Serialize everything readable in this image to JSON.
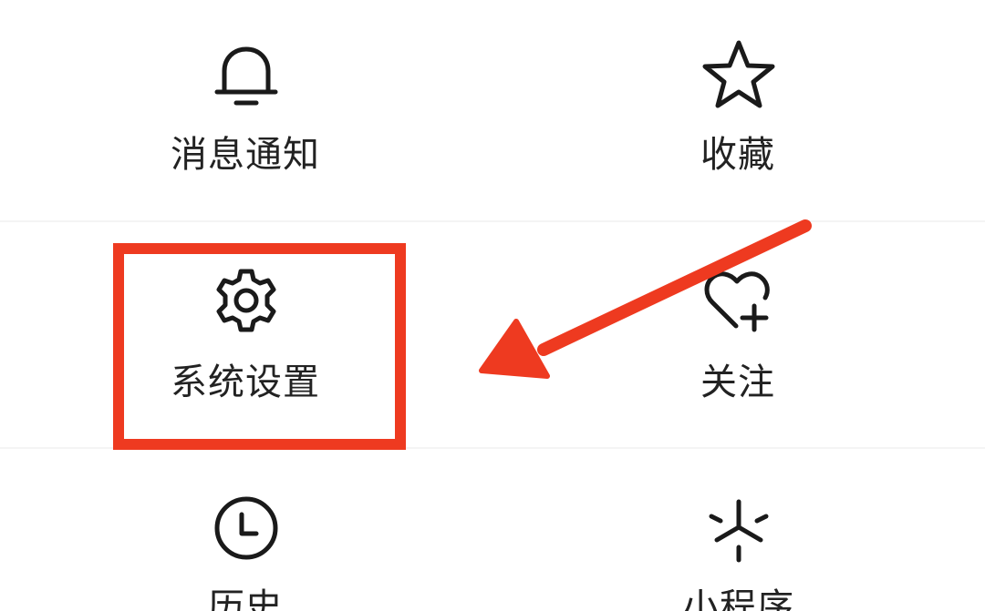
{
  "menu": {
    "items": [
      {
        "label": "消息通知",
        "icon": "bell-icon"
      },
      {
        "label": "收藏",
        "icon": "star-icon"
      },
      {
        "label": "系统设置",
        "icon": "gear-icon"
      },
      {
        "label": "关注",
        "icon": "heart-plus-icon"
      },
      {
        "label": "历史",
        "icon": "clock-icon"
      },
      {
        "label": "小程序",
        "icon": "mini-program-icon"
      }
    ]
  },
  "annotation": {
    "highlighted_item": "系统设置",
    "color": "#ee3a20"
  }
}
